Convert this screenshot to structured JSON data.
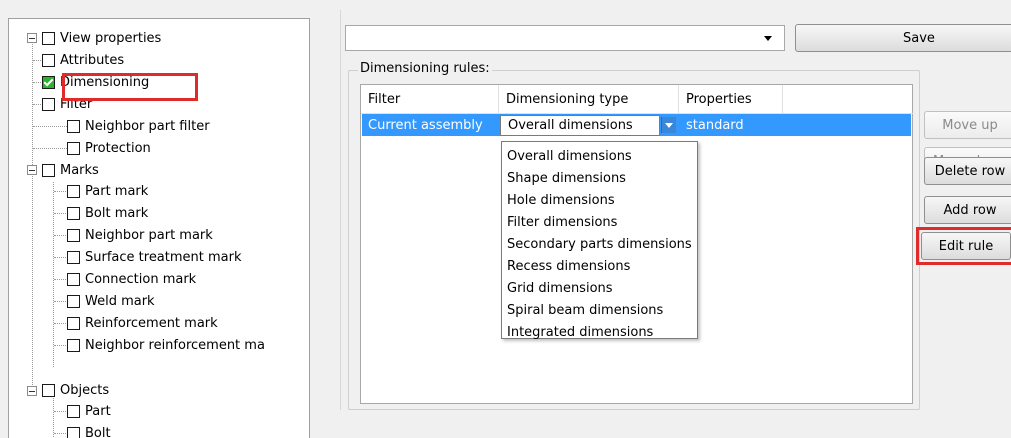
{
  "tree": {
    "root": "View properties",
    "items": [
      {
        "label": "Attributes",
        "checked": false
      },
      {
        "label": "Dimensioning",
        "checked": true
      },
      {
        "label": "Filter",
        "checked": false
      },
      {
        "label": "Neighbor part filter",
        "checked": false
      },
      {
        "label": "Protection",
        "checked": false
      }
    ],
    "marks": {
      "label": "Marks",
      "children": [
        "Part mark",
        "Bolt mark",
        "Neighbor part mark",
        "Surface treatment mark",
        "Connection mark",
        "Weld mark",
        "Reinforcement mark",
        "Neighbor reinforcement ma"
      ]
    },
    "objects": {
      "label": "Objects",
      "children": [
        "Part",
        "Bolt"
      ]
    }
  },
  "toolbar": {
    "combo_value": "",
    "save_label": "Save"
  },
  "rules": {
    "group_label": "Dimensioning rules:",
    "columns": [
      "Filter",
      "Dimensioning type",
      "Properties"
    ],
    "rows": [
      {
        "filter": "Current assembly",
        "type": "Overall dimensions",
        "properties": "standard"
      }
    ],
    "dropdown_options": [
      "Overall dimensions",
      "Shape dimensions",
      "Hole dimensions",
      "Filter dimensions",
      "Secondary parts dimensions",
      "Recess dimensions",
      "Grid dimensions",
      "Spiral beam dimensions",
      "Integrated dimensions"
    ]
  },
  "buttons": {
    "move_up": "Move up",
    "move_down": "Move down",
    "delete_row": "Delete row",
    "add_row": "Add row",
    "edit_rule": "Edit rule"
  },
  "colors": {
    "selection": "#3399ff",
    "highlight": "#e02b2b",
    "check": "#2bb42b"
  }
}
